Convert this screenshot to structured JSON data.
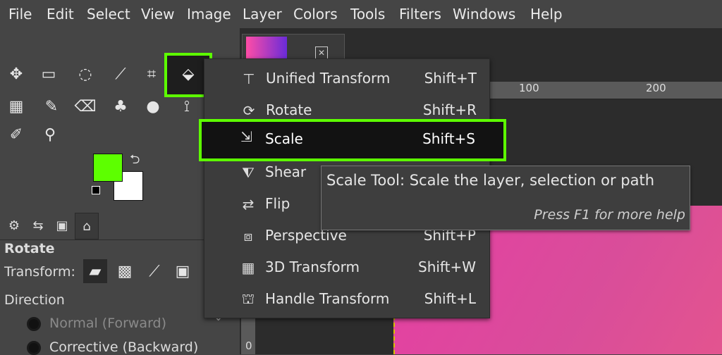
{
  "menubar": {
    "items": [
      "File",
      "Edit",
      "Select",
      "View",
      "Image",
      "Layer",
      "Colors",
      "Tools",
      "Filters",
      "Windows",
      "Help"
    ]
  },
  "toolbox": {
    "icons": [
      "move-icon",
      "rect-select-icon",
      "lasso-icon",
      "fuzzy-select-icon",
      "crop-icon",
      "transform-group-icon",
      "bucket-fill-icon",
      "paintbrush-icon",
      "eraser-icon",
      "clone-icon",
      "dodge-burn-icon",
      "path-icon",
      "color-picker-icon",
      "zoom-icon"
    ],
    "colors": {
      "foreground": "#5dff00",
      "background": "#ffffff"
    }
  },
  "tool_options": {
    "title": "Rotate",
    "transform_label": "Transform:",
    "direction_label": "Direction",
    "radio_options": [
      "Normal (Forward)",
      "Corrective (Backward)"
    ]
  },
  "ruler": {
    "ticks": [
      "100",
      "200"
    ]
  },
  "vruler": {
    "ticks": [
      "0"
    ]
  },
  "transform_menu": {
    "items": [
      {
        "label": "Unified Transform",
        "shortcut": "Shift+T",
        "icon": "unified-transform-icon"
      },
      {
        "label": "Rotate",
        "shortcut": "Shift+R",
        "icon": "rotate-icon"
      },
      {
        "label": "Scale",
        "shortcut": "Shift+S",
        "icon": "scale-icon"
      },
      {
        "label": "Shear",
        "shortcut": "",
        "icon": "shear-icon"
      },
      {
        "label": "Flip",
        "shortcut": "",
        "icon": "flip-icon"
      },
      {
        "label": "Perspective",
        "shortcut": "Shift+P",
        "icon": "perspective-icon"
      },
      {
        "label": "3D Transform",
        "shortcut": "Shift+W",
        "icon": "3d-transform-icon"
      },
      {
        "label": "Handle Transform",
        "shortcut": "Shift+L",
        "icon": "handle-transform-icon"
      }
    ]
  },
  "tooltip": {
    "title": "Scale Tool: Scale the layer, selection or path",
    "help": "Press F1 for more help"
  },
  "accent_color": "#5dff00"
}
